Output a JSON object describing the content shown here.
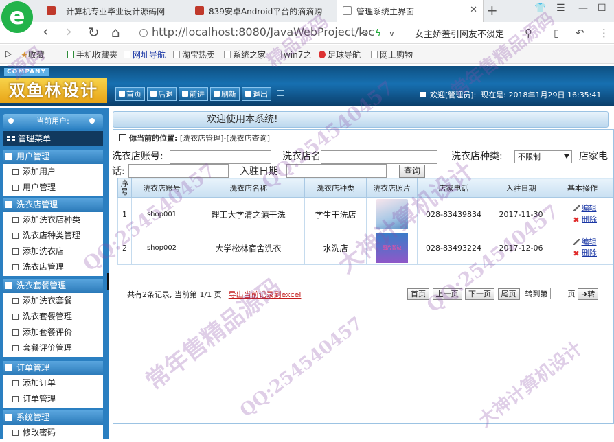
{
  "browser": {
    "tabs": [
      {
        "title": "- 计算机专业毕业设计源码网"
      },
      {
        "title": "839安卓Android平台的滴滴购"
      },
      {
        "title": "管理系统主界面"
      }
    ],
    "tab_close": "✕",
    "new_tab": "+",
    "url": "http://localhost:8080/JavaWebProject/loc",
    "hot_search": "女主娇羞引网友不淡定",
    "bookmarks": [
      "收藏",
      "手机收藏夹",
      "网址导航",
      "淘宝热卖",
      "系统之家",
      "win7之",
      "足球导航",
      "网上购物"
    ]
  },
  "app": {
    "company_tag": "COMPANY",
    "brand": "双鱼林设计",
    "top_buttons": [
      "首页",
      "后退",
      "前进",
      "刷新",
      "退出"
    ],
    "welcome": "欢迎[管理员]:",
    "now": "现在是: 2018年1月29日  16:35:41"
  },
  "sidebar": {
    "current_user": "当前用户:",
    "menu_title": "管理菜单",
    "groups": [
      {
        "title": "用户管理",
        "items": [
          "添加用户",
          "用户管理"
        ]
      },
      {
        "title": "洗衣店管理",
        "items": [
          "添加洗衣店种类",
          "洗衣店种类管理",
          "添加洗衣店",
          "洗衣店管理"
        ]
      },
      {
        "title": "洗衣套餐管理",
        "items": [
          "添加洗衣套餐",
          "洗衣套餐管理",
          "添加套餐评价",
          "套餐评价管理"
        ]
      },
      {
        "title": "订单管理",
        "items": [
          "添加订单",
          "订单管理"
        ]
      },
      {
        "title": "系统管理",
        "items": [
          "修改密码"
        ]
      }
    ]
  },
  "main": {
    "welcome_bar": "欢迎使用本系统!",
    "location_label": "你当前的位置:",
    "location_path": "[洗衣店管理]-[洗衣店查询]",
    "search": {
      "account_label": "洗衣店账号:",
      "name_label": "洗衣店名称:",
      "type_label": "洗衣店种类:",
      "type_value": "不限制",
      "phone_label_1": "店家电",
      "phone_label_2": "话:",
      "date_label": "入驻日期:",
      "query_button": "查询"
    },
    "table": {
      "headers": [
        "序号",
        "洗衣店账号",
        "洗衣店名称",
        "洗衣店种类",
        "洗衣店照片",
        "店家电话",
        "入驻日期",
        "基本操作"
      ],
      "rows": [
        {
          "no": "1",
          "account": "shop001",
          "name": "理工大学清之源干洗",
          "type": "学生干洗店",
          "phone": "028-83439834",
          "date": "2017-11-30"
        },
        {
          "no": "2",
          "account": "shop002",
          "name": "大学松林宿舍洗衣",
          "type": "水洗店",
          "phone": "028-83493224",
          "date": "2017-12-06",
          "photo_text": "图片暂缺"
        }
      ],
      "edit_label": "编辑",
      "delete_label": "删除"
    },
    "pager": {
      "summary": "共有2条记录, 当前第 1/1 页",
      "export": "导出当前记录到excel",
      "first": "首页",
      "prev": "上一页",
      "next": "下一页",
      "last": "尾页",
      "goto_label": "转到第",
      "page_unit": "页",
      "go": "转"
    }
  },
  "watermarks": [
    "常年售精品源码",
    "QQ:254540457",
    "大神计算机设计",
    "QQ:254540457",
    "常年售精品源码",
    "QQ:254540457",
    "大神计算机设计",
    "QQ:254540457",
    "源码",
    "精品源码"
  ]
}
